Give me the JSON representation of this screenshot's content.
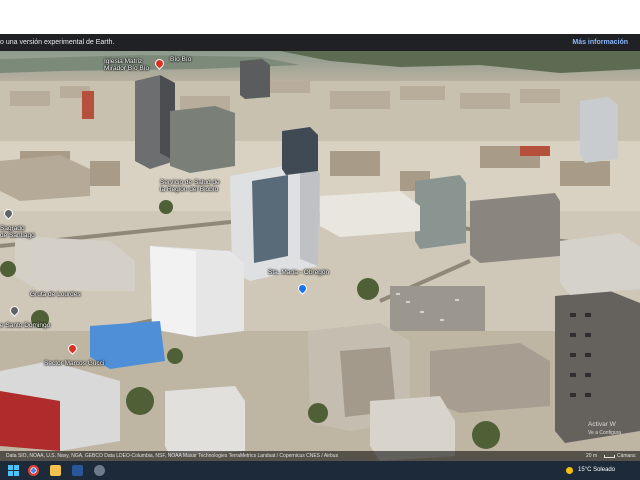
{
  "notice": {
    "message": "o una versión experimental de Earth.",
    "more_info": "Más información"
  },
  "map_labels": {
    "upper_left_place": "Iglesia Matriz\nMirador Bío Bío",
    "upper_left_tag": "Bío Bío",
    "health_service": "Servicio de Salud de\nla Región del Biobío",
    "left_edge_1": "Sagrado\nde Santiago",
    "gruta": "Gruta de Lourdes",
    "santo_domingo": "e Santo Domingo",
    "center_place": "Sta. María - Obregón",
    "lower_left_place": "Sector Marcos Gucci"
  },
  "attribution": {
    "sources": "Data SIO, NOAA, U.S. Navy, NGA, GEBCO  Data LDEO-Columbia, NSF, NOAA  Maxar Technologies  TerraMetrics  Landsat / Copernicus  CNES / Airbus",
    "scale": "20 m",
    "camera": "Cámara: 13"
  },
  "watermark": {
    "title": "Activar W",
    "subtitle": "Ve a Configura"
  },
  "taskbar": {
    "weather": "15°C  Soleado",
    "icons": [
      "windows-icon",
      "chrome-icon",
      "explorer-icon",
      "word-icon",
      "settings-icon"
    ]
  },
  "colors": {
    "pin_blue": "#1a73e8",
    "pin_red": "#d93025",
    "taskbar": "#1c2a3a",
    "notice_bar": "#202124",
    "link": "#8ab4f8"
  }
}
